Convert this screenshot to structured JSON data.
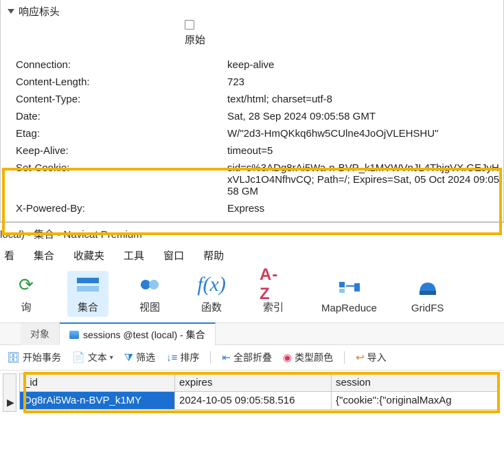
{
  "devtools": {
    "section_title": "响应标头",
    "raw_label": "原始",
    "headers": [
      {
        "key": "Connection:",
        "value": "keep-alive"
      },
      {
        "key": "Content-Length:",
        "value": "723"
      },
      {
        "key": "Content-Type:",
        "value": "text/html; charset=utf-8"
      },
      {
        "key": "Date:",
        "value": "Sat, 28 Sep 2024 09:05:58 GMT"
      },
      {
        "key": "Etag:",
        "value": "W/\"2d3-HmQKkq6hw5CUlne4JoOjVLEHSHU\""
      },
      {
        "key": "Keep-Alive:",
        "value": "timeout=5"
      },
      {
        "key": "Set-Cookie:",
        "value": "sid=s%3ADg8rAi5Wa-n-BVP_k1MYWVnJL4ThjgVX.GEJyHxVLJc1O4NfhvCQ; Path=/; Expires=Sat, 05 Oct 2024 09:05:58 GM"
      },
      {
        "key": "X-Powered-By:",
        "value": "Express"
      }
    ]
  },
  "navicat": {
    "window_title": "local) - 集合 - Navicat Premium",
    "menu": {
      "view": "看",
      "collection": "集合",
      "fav": "收藏夹",
      "tools": "工具",
      "window": "窗口",
      "help": "帮助"
    },
    "toolbar": {
      "refresh": "询",
      "collection": "集合",
      "view": "视图",
      "func": "函数",
      "index": "索引",
      "mapreduce": "MapReduce",
      "gridfs": "GridFS",
      "index_icon_text": "A-Z",
      "func_icon_text": "f(x)"
    },
    "tabs": {
      "objects": "对象",
      "sessions": "sessions @test (local) - 集合"
    },
    "actions": {
      "start_tx": "开始事务",
      "text": "文本",
      "filter": "筛选",
      "sort": "排序",
      "collapse_all": "全部折叠",
      "type_color": "类型颜色",
      "import": "导入"
    },
    "grid": {
      "columns": {
        "id": "_id",
        "expires": "expires",
        "session": "session"
      },
      "row": {
        "id": "Dg8rAi5Wa-n-BVP_k1MY",
        "expires": "2024-10-05 09:05:58.516",
        "session": "{\"cookie\":{\"originalMaxAg"
      }
    }
  }
}
